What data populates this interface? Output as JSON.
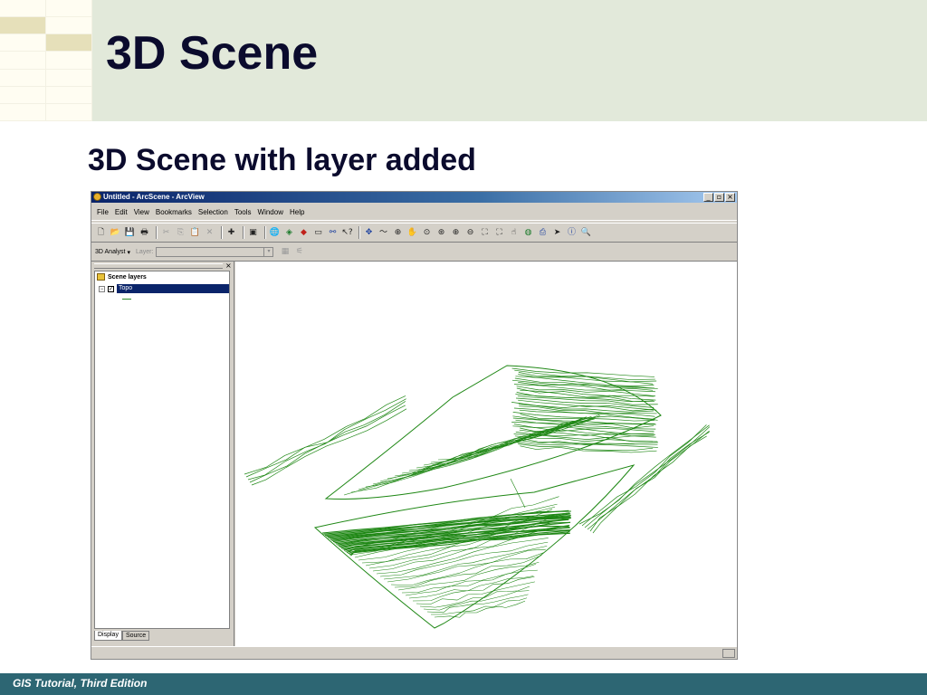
{
  "slide": {
    "title": "3D Scene",
    "subtitle": "3D Scene with layer added",
    "footer": "GIS Tutorial, Third Edition"
  },
  "window": {
    "title": "Untitled - ArcScene - ArcView",
    "controls": {
      "minimize": "_",
      "maximize": "▫",
      "close": "×"
    }
  },
  "menu": [
    "File",
    "Edit",
    "View",
    "Bookmarks",
    "Selection",
    "Tools",
    "Window",
    "Help"
  ],
  "toolbar2": {
    "analyst_label": "3D Analyst",
    "analyst_arrow": "▾",
    "layer_label": "Layer:",
    "layer_value": ""
  },
  "toc": {
    "root_label": "Scene layers",
    "layer_name": "Topo",
    "expander": "−",
    "checked": "✓",
    "close": "×",
    "tabs": [
      "Display",
      "Source"
    ]
  },
  "icons": {
    "new": "🗋",
    "open": "📂",
    "save": "💾",
    "print": "🖶",
    "cut": "✂",
    "copy": "⎘",
    "paste": "📋",
    "delete": "✕",
    "add_data": "✚",
    "toc": "▣",
    "globe": "🌐",
    "scene_props": "◈",
    "arctoolbox": "◆",
    "window": "▭",
    "graph": "⚯",
    "whats_this": "↖?",
    "navigate": "✥",
    "fly": "〜",
    "zoom_in_out": "⊕",
    "pan": "✋",
    "center": "⊙",
    "target": "⊛",
    "zoom_in": "⊕",
    "zoom_out": "⊖",
    "full_extent": "⛶",
    "narrow": "⛶",
    "hand": "☝",
    "earth": "◍",
    "identify_set": "⎙",
    "select": "➤",
    "identify": "ⓘ",
    "find": "🔍",
    "toolbar2_a": "▦",
    "toolbar2_b": "⚟"
  },
  "colors": {
    "contour": "#1e8714",
    "header_band": "#e2e9da",
    "footer": "#2d6673",
    "title_text": "#0b0b2d",
    "selection": "#0a246a"
  }
}
